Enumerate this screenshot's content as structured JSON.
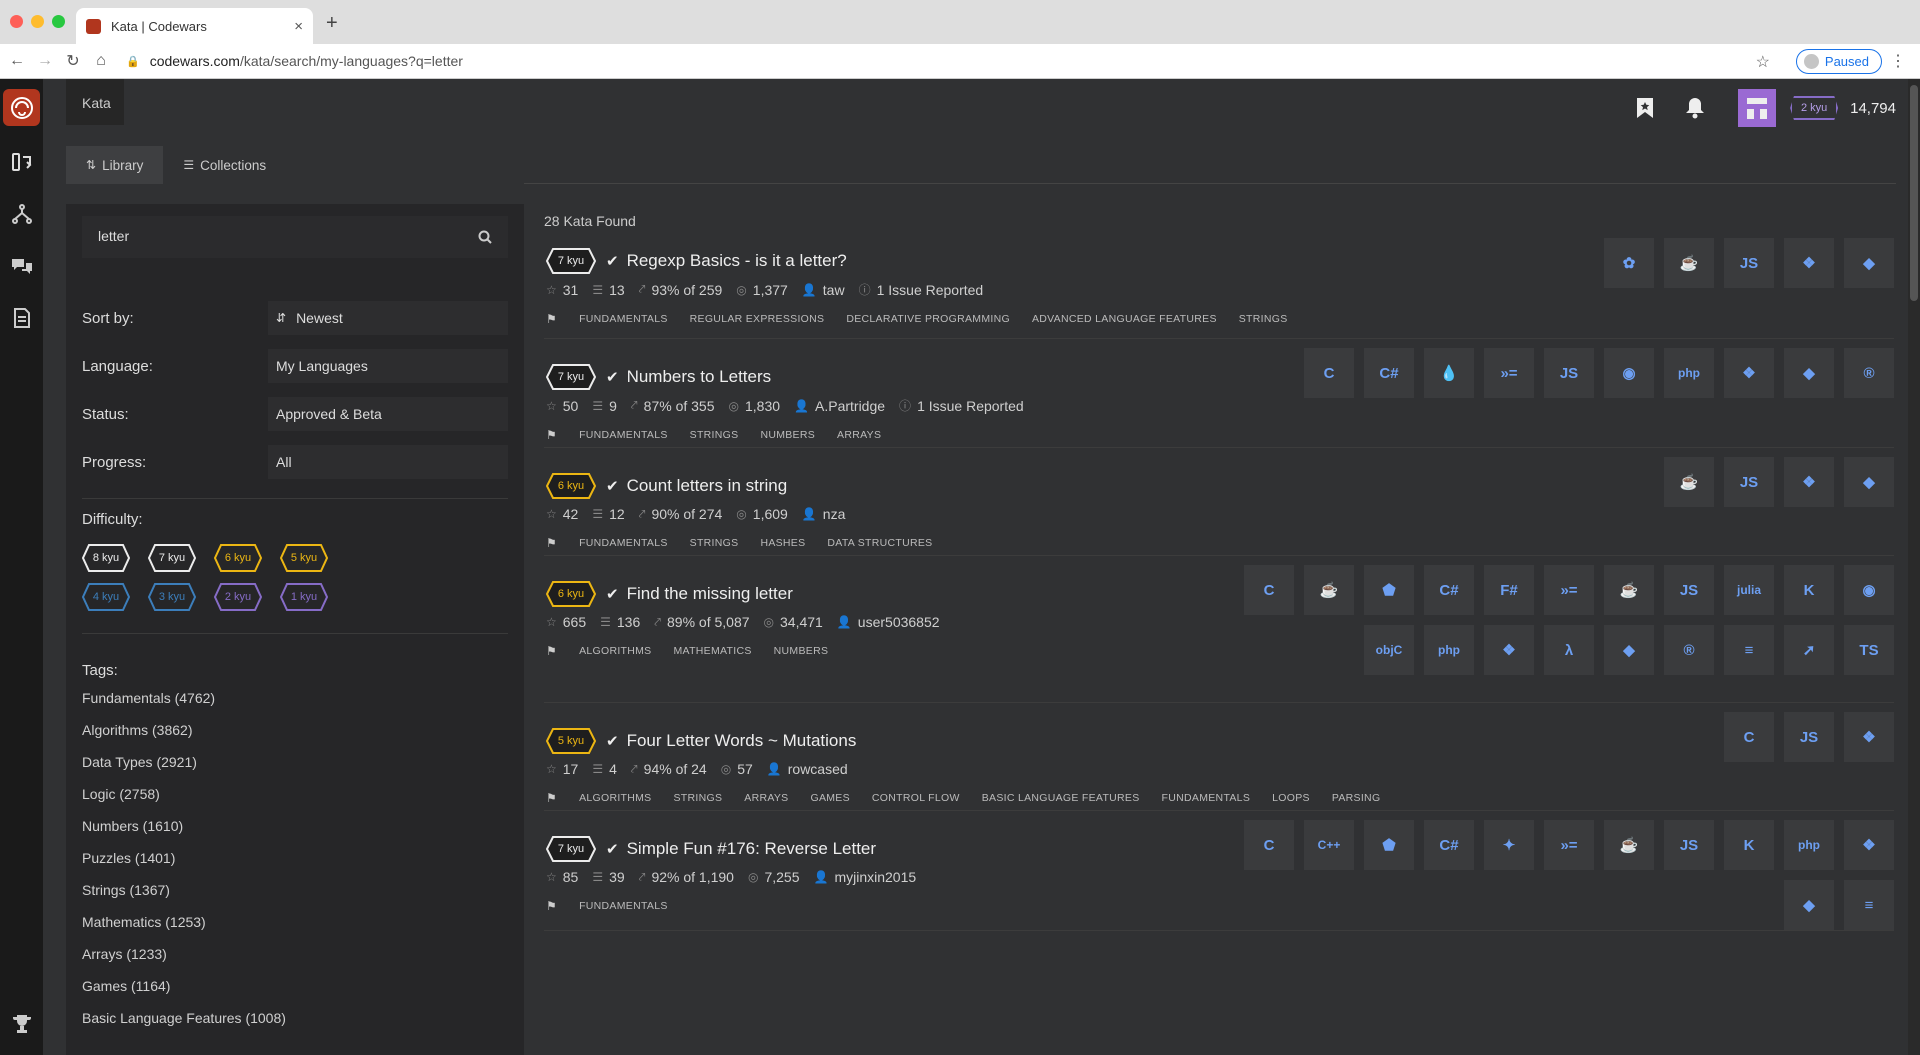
{
  "browser": {
    "tab_title": "Kata | Codewars",
    "new_tab": "+",
    "tab_close": "×",
    "url_host": "codewars.com",
    "url_path": "/kata/search/my-languages?q=letter",
    "profile_label": "Paused"
  },
  "header": {
    "breadcrumb": "Kata",
    "rank": "2 kyu",
    "honor": "14,794"
  },
  "subtabs": [
    {
      "label": "Library"
    },
    {
      "label": "Collections"
    }
  ],
  "filters": {
    "search_value": "letter",
    "sort_label": "Sort by:",
    "sort_value": "Newest",
    "language_label": "Language:",
    "language_value": "My Languages",
    "status_label": "Status:",
    "status_value": "Approved & Beta",
    "progress_label": "Progress:",
    "progress_value": "All",
    "difficulty_label": "Difficulty:",
    "difficulties": [
      {
        "label": "8 kyu",
        "color": "#ececec"
      },
      {
        "label": "7 kyu",
        "color": "#ececec"
      },
      {
        "label": "6 kyu",
        "color": "#ecb613"
      },
      {
        "label": "5 kyu",
        "color": "#ecb613"
      },
      {
        "label": "4 kyu",
        "color": "#3c7ebb"
      },
      {
        "label": "3 kyu",
        "color": "#3c7ebb"
      },
      {
        "label": "2 kyu",
        "color": "#866cc7"
      },
      {
        "label": "1 kyu",
        "color": "#866cc7"
      }
    ],
    "tags_label": "Tags:",
    "tags": [
      "Fundamentals (4762)",
      "Algorithms (3862)",
      "Data Types (2921)",
      "Logic (2758)",
      "Numbers (1610)",
      "Puzzles (1401)",
      "Strings (1367)",
      "Mathematics (1253)",
      "Arrays (1233)",
      "Games (1164)",
      "Basic Language Features (1008)"
    ]
  },
  "results": {
    "found": "28 Kata Found",
    "items": [
      {
        "kyu": "7 kyu",
        "kyu_color": "#ececec",
        "title": "Regexp Basics - is it a letter?",
        "stars": "31",
        "collections": "13",
        "satisfaction": "93% of 259",
        "completed": "1,377",
        "author": "taw",
        "issues": "1 Issue Reported",
        "tags": [
          "FUNDAMENTALS",
          "REGULAR EXPRESSIONS",
          "DECLARATIVE PROGRAMMING",
          "ADVANCED LANGUAGE FEATURES",
          "STRINGS"
        ],
        "languages": [
          "crystal-icon",
          "java-icon",
          "javascript-icon",
          "python-icon",
          "ruby-icon"
        ]
      },
      {
        "kyu": "7 kyu",
        "kyu_color": "#ececec",
        "title": "Numbers to Letters",
        "stars": "50",
        "collections": "9",
        "satisfaction": "87% of 355",
        "completed": "1,830",
        "author": "A.Partridge",
        "issues": "1 Issue Reported",
        "tags": [
          "FUNDAMENTALS",
          "STRINGS",
          "NUMBERS",
          "ARRAYS"
        ],
        "languages": [
          "c-icon",
          "csharp-icon",
          "elixir-icon",
          "haskell-icon",
          "javascript-icon",
          "nasm-icon",
          "php-icon",
          "python-icon",
          "ruby-icon",
          "rust-icon"
        ]
      },
      {
        "kyu": "6 kyu",
        "kyu_color": "#ecb613",
        "title": "Count letters in string",
        "stars": "42",
        "collections": "12",
        "satisfaction": "90% of 274",
        "completed": "1,609",
        "author": "nza",
        "issues": "",
        "tags": [
          "FUNDAMENTALS",
          "STRINGS",
          "HASHES",
          "DATA STRUCTURES"
        ],
        "languages": [
          "coffeescript-icon",
          "javascript-icon",
          "python-icon",
          "ruby-icon"
        ]
      },
      {
        "kyu": "6 kyu",
        "kyu_color": "#ecb613",
        "title": "Find the missing letter",
        "stars": "665",
        "collections": "136",
        "satisfaction": "89% of 5,087",
        "completed": "34,471",
        "author": "user5036852",
        "issues": "",
        "tags": [
          "ALGORITHMS",
          "MATHEMATICS",
          "NUMBERS"
        ],
        "languages": [
          "c-icon",
          "coffeescript-icon",
          "clojure-icon",
          "csharp-icon",
          "fsharp-icon",
          "haskell-icon",
          "java-icon",
          "javascript-icon",
          "julia-icon",
          "kotlin-icon",
          "nasm-icon",
          "objc-icon",
          "php-icon",
          "python-icon",
          "racket-icon",
          "ruby-icon",
          "rust-icon",
          "scala-icon",
          "swift-icon",
          "typescript-icon"
        ]
      },
      {
        "kyu": "5 kyu",
        "kyu_color": "#ecb613",
        "title": "Four Letter Words ~ Mutations",
        "stars": "17",
        "collections": "4",
        "satisfaction": "94% of 24",
        "completed": "57",
        "author": "rowcased",
        "issues": "",
        "tags": [
          "ALGORITHMS",
          "STRINGS",
          "ARRAYS",
          "GAMES",
          "CONTROL FLOW",
          "BASIC LANGUAGE FEATURES",
          "FUNDAMENTALS",
          "LOOPS",
          "PARSING"
        ],
        "languages": [
          "c-icon",
          "javascript-icon",
          "python-icon"
        ]
      },
      {
        "kyu": "7 kyu",
        "kyu_color": "#ececec",
        "title": "Simple Fun #176: Reverse Letter",
        "stars": "85",
        "collections": "39",
        "satisfaction": "92% of 1,190",
        "completed": "7,255",
        "author": "myjinxin2015",
        "issues": "",
        "tags": [
          "FUNDAMENTALS"
        ],
        "languages": [
          "c-icon",
          "cpp-icon",
          "clojure-icon",
          "csharp-icon",
          "elm-icon",
          "haskell-icon",
          "java-icon",
          "javascript-icon",
          "kotlin-icon",
          "php-icon",
          "python-icon",
          "ruby-icon",
          "scala-icon"
        ]
      }
    ]
  }
}
